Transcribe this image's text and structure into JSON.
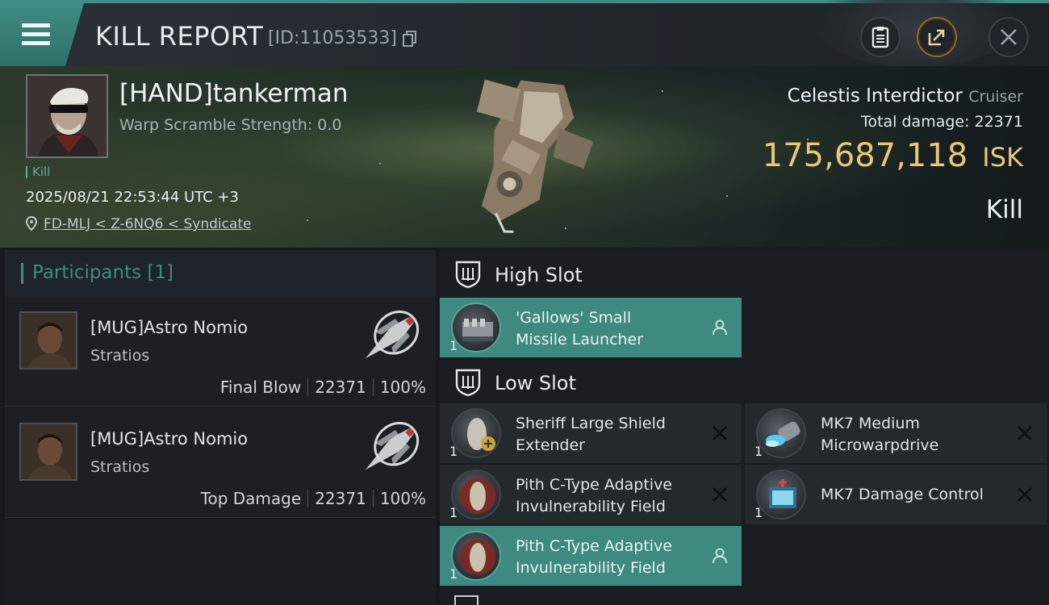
{
  "header": {
    "title": "KILL REPORT",
    "id_text": "[ID:11053533]"
  },
  "victim": {
    "name": "[HAND]tankerman",
    "scramble": "Warp Scramble Strength: 0.0",
    "kill_tag": "Kill",
    "timestamp": "2025/08/21 22:53:44 UTC +3",
    "location": "FD-MLJ < Z-6NQ6 < Syndicate",
    "ship_name": "Celestis Interdictor",
    "ship_class": "Cruiser",
    "total_damage_label": "Total damage:",
    "total_damage": "22371",
    "isk_value": "175,687,118",
    "isk_unit": "ISK",
    "result": "Kill"
  },
  "participants": {
    "header": "Participants [1]",
    "items": [
      {
        "name": "[MUG]Astro Nomio",
        "ship": "Stratios",
        "role": "Final Blow",
        "damage": "22371",
        "percent": "100%"
      },
      {
        "name": "[MUG]Astro Nomio",
        "ship": "Stratios",
        "role": "Top Damage",
        "damage": "22371",
        "percent": "100%"
      }
    ]
  },
  "slots": {
    "high": {
      "label": "High Slot",
      "modules": [
        {
          "line1": "'Gallows' Small",
          "line2": "Missile Launcher",
          "qty": "1",
          "status": "fitted"
        }
      ]
    },
    "low": {
      "label": "Low Slot",
      "modules": [
        {
          "line1": "Sheriff Large Shield",
          "line2": "Extender",
          "qty": "1",
          "status": "destroyed"
        },
        {
          "line1": "MK7 Medium",
          "line2": "Microwarpdrive",
          "qty": "1",
          "status": "destroyed"
        },
        {
          "line1": "Pith C-Type Adaptive",
          "line2": "Invulnerability Field",
          "qty": "1",
          "status": "destroyed"
        },
        {
          "line1": "MK7 Damage Control",
          "line2": "",
          "qty": "1",
          "status": "destroyed"
        },
        {
          "line1": "Pith C-Type Adaptive",
          "line2": "Invulnerability Field",
          "qty": "1",
          "status": "fitted"
        }
      ]
    }
  },
  "colors": {
    "accent": "#3f8a80",
    "isk": "#e8c67a"
  }
}
